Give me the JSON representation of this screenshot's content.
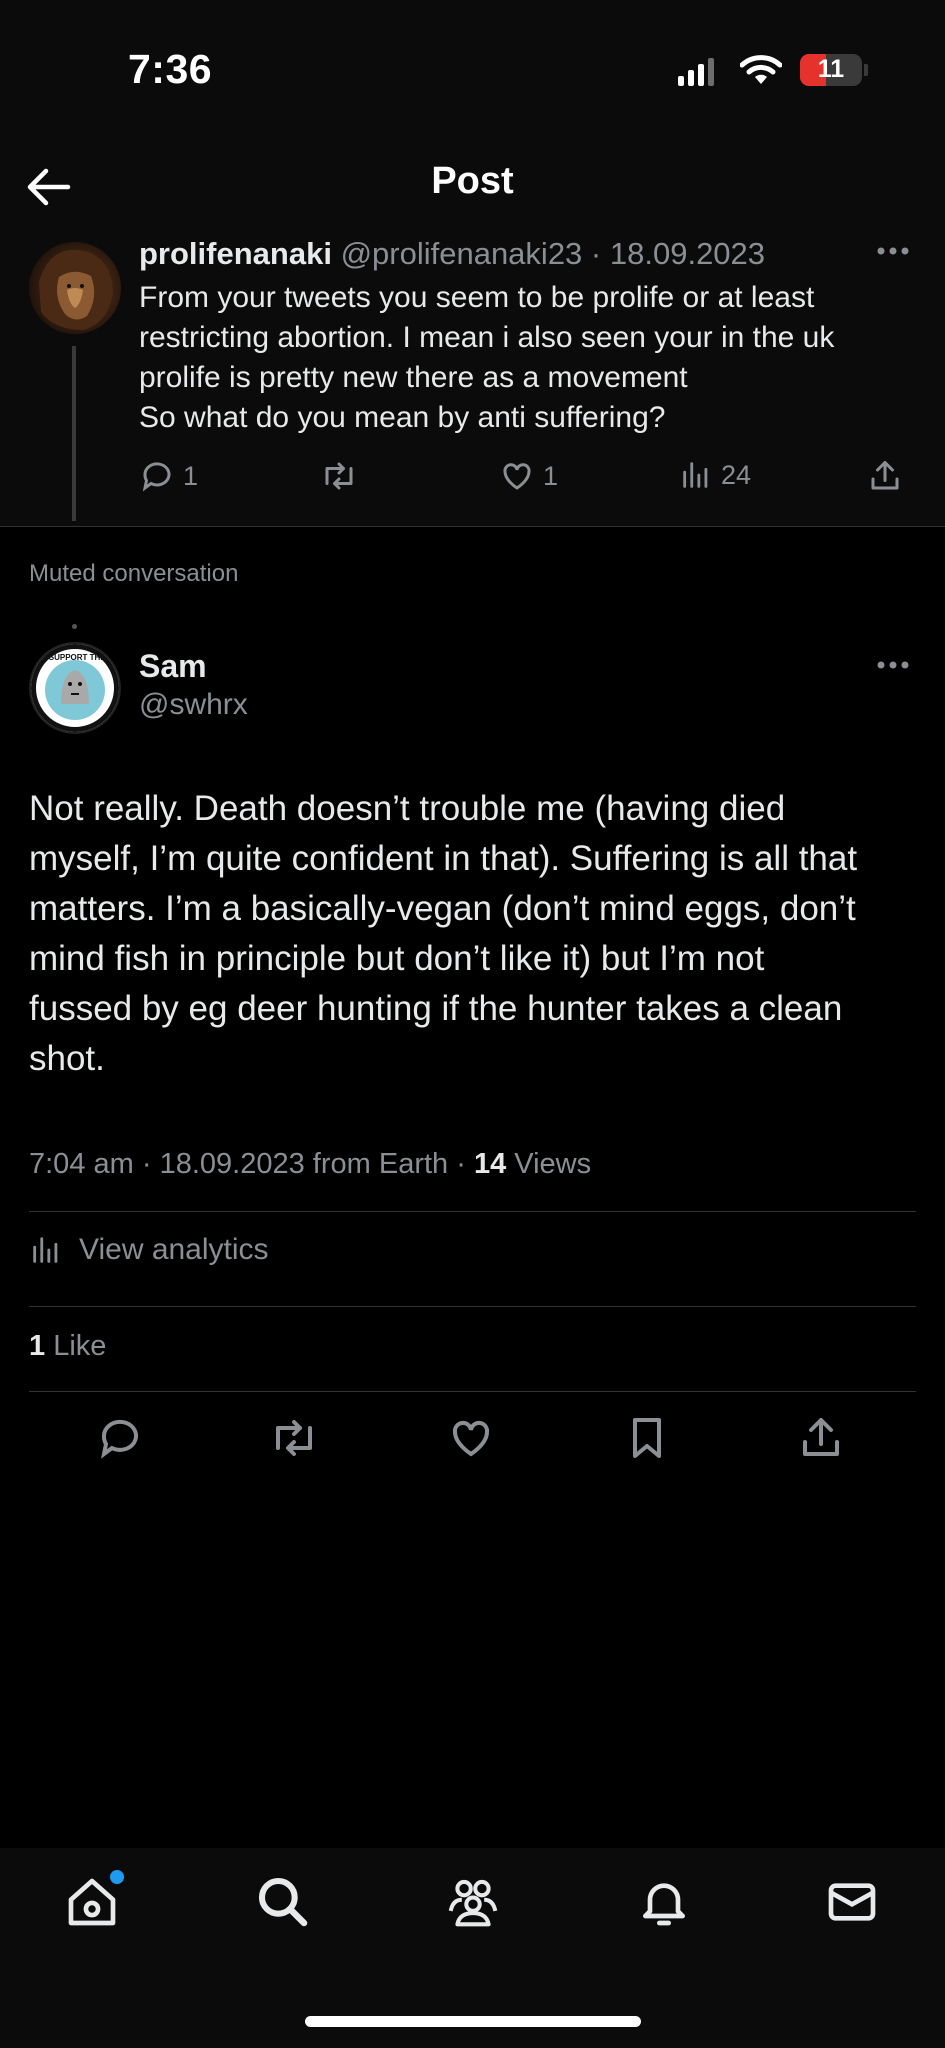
{
  "status_bar": {
    "time": "7:36",
    "battery_level": "11",
    "icons": [
      "cellular-signal-icon",
      "wifi-icon",
      "battery-icon"
    ]
  },
  "header": {
    "title": "Post",
    "back_icon": "arrow-left-icon"
  },
  "parent_tweet": {
    "author_name": "prolifenanaki",
    "author_handle": "@prolifenanaki23",
    "date": "18.09.2023",
    "separator": "·",
    "text_lines": [
      "From your tweets you seem to be prolife or at least",
      "restricting abortion. I mean i also seen your in the uk",
      "prolife is pretty new there as a movement",
      "So what do you mean by anti suffering?"
    ],
    "replies": "1",
    "likes": "1",
    "views": "24"
  },
  "muted_label": "Muted conversation",
  "main_tweet": {
    "author_name": "Sam",
    "author_handle": "@swhrx",
    "avatar_text": "I SUPPORT THE",
    "text_lines": [
      "Not really. Death doesn’t trouble me (having died",
      "myself, I’m quite confident in that). Suffering is all that",
      "matters. I’m a basically-vegan (don’t mind eggs, don’t",
      "mind fish in principle but don’t like it) but I’m not",
      "fussed by eg deer hunting if the hunter takes a clean",
      "shot."
    ],
    "meta_time": "7:04 am",
    "meta_date": "18.09.2023",
    "meta_source": "from Earth",
    "views_count": "14",
    "views_label": "Views",
    "analytics_label": "View analytics",
    "likes_count": "1",
    "likes_label": "Like"
  },
  "bottom_nav": {
    "items": [
      "home-icon",
      "search-icon",
      "communities-icon",
      "notifications-icon",
      "messages-icon"
    ]
  },
  "colors": {
    "background": "#000000",
    "text": "#e7e9ea",
    "secondary": "#8b8f93",
    "accent": "#1d9bf0",
    "battery_low": "#e5322d"
  }
}
